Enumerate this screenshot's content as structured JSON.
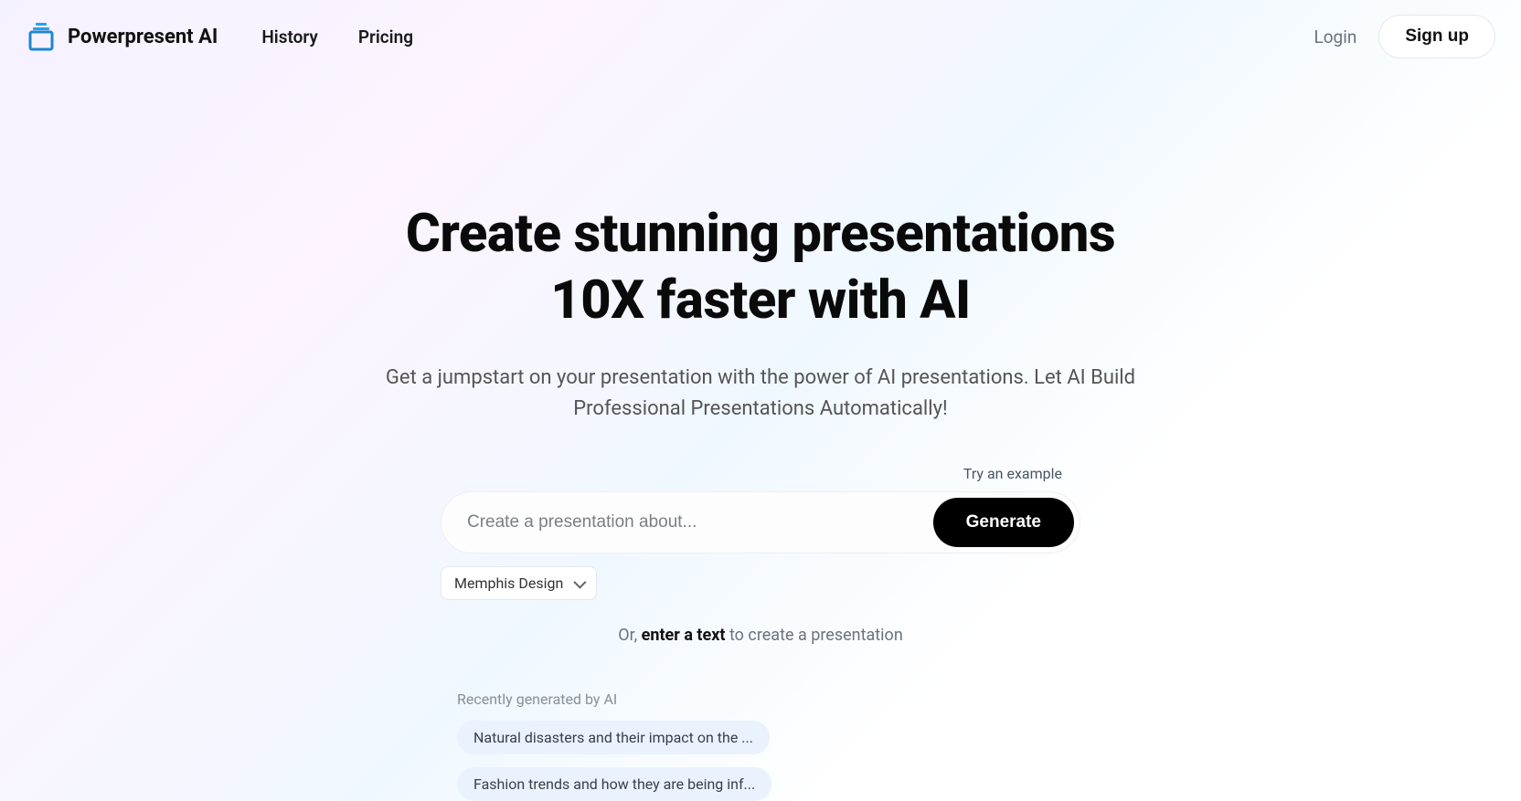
{
  "header": {
    "brand": "Powerpresent AI",
    "nav": {
      "history": "History",
      "pricing": "Pricing"
    },
    "login": "Login",
    "signup": "Sign up"
  },
  "hero": {
    "headline_l1": "Create stunning presentations",
    "headline_l2": "10X faster with AI",
    "subhead": "Get a jumpstart on your presentation with the power of AI presentations. Let AI Build Professional Presentations Automatically!"
  },
  "form": {
    "try_example": "Try an example",
    "placeholder": "Create a presentation about...",
    "generate": "Generate",
    "style_selected": "Memphis Design",
    "or_prefix": "Or, ",
    "or_bold": "enter a text",
    "or_suffix": " to create a presentation"
  },
  "recent": {
    "label": "Recently generated by AI",
    "items": [
      "Natural disasters and their impact on the ...",
      "Fashion trends and how they are being inf..."
    ]
  }
}
